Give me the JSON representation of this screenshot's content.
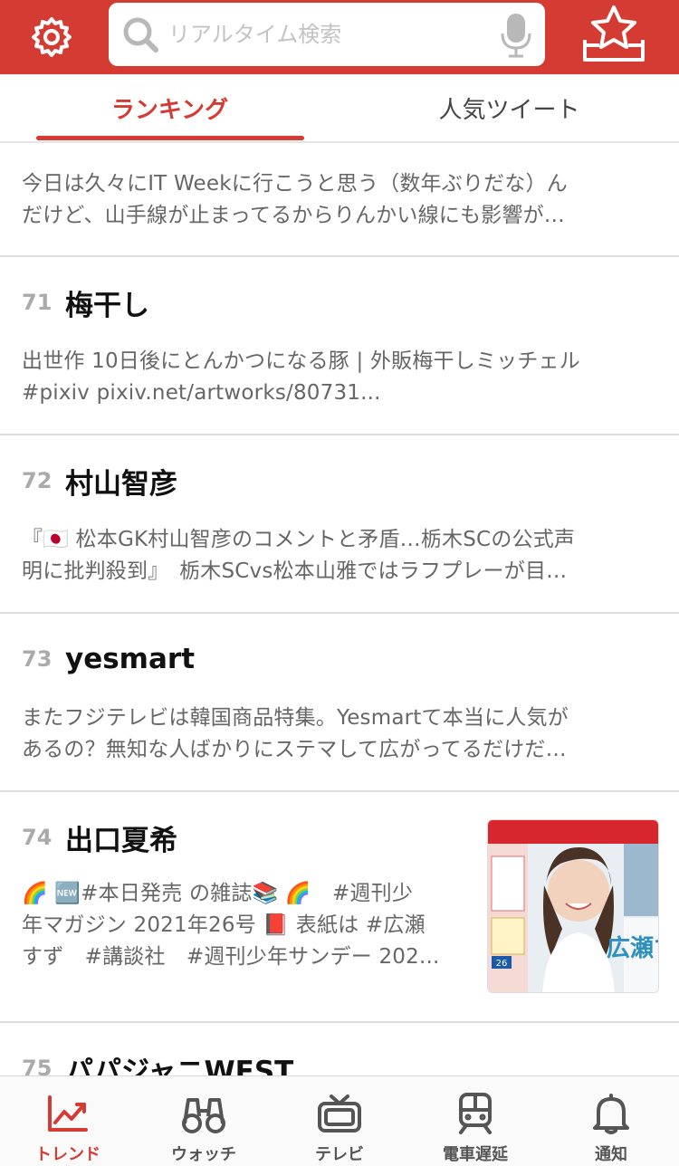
{
  "header": {
    "search_placeholder": "リアルタイム検索",
    "icons": {
      "settings": "gear-icon",
      "search": "search-icon",
      "mic": "microphone-icon",
      "saved": "star-tray-icon"
    }
  },
  "tabs": [
    {
      "label": "ランキング",
      "active": true
    },
    {
      "label": "人気ツイート",
      "active": false
    }
  ],
  "feed": {
    "top_snippet": [
      "今日は久々にIT Weekに行こうと思う（数年ぶりだな）ん",
      "だけど、山手線が止まってるからりんかい線にも影響が…"
    ],
    "items": [
      {
        "rank": "71",
        "title": "梅干し",
        "lines": [
          "出世作 10日後にとんかつになる豚 | 外販梅干しミッチェル",
          "#pixiv pixiv.net/artworks/80731..."
        ]
      },
      {
        "rank": "72",
        "title": "村山智彦",
        "lines": [
          "『🇯🇵 松本GK村山智彦のコメントと矛盾…栃木SCの公式声",
          "明に批判殺到』　栃木SCvs松本山雅ではラフプレーが目…"
        ]
      },
      {
        "rank": "73",
        "title": "yesmart",
        "lines": [
          "またフジテレビは韓国商品特集。Yesmartて本当に人気が",
          "あるの？無知な人ばかりにステマして広がってるだけだ…"
        ]
      },
      {
        "rank": "74",
        "title": "出口夏希",
        "lines": [
          "🌈 🆕#本日発売 の雑誌📚 🌈　#週刊少",
          "年マガジン 2021年26号 📕 表紙は #広瀬",
          "すず　#講談社　#週刊少年サンデー 202..."
        ],
        "thumbnail": {
          "cover_text": "広瀬す",
          "number": "26"
        }
      },
      {
        "rank": "75",
        "title": "パパジャニWEST"
      }
    ]
  },
  "bottom_nav": [
    {
      "label": "トレンド",
      "icon": "trend-chart-icon",
      "active": true
    },
    {
      "label": "ウォッチ",
      "icon": "binoculars-icon",
      "active": false
    },
    {
      "label": "テレビ",
      "icon": "tv-icon",
      "active": false
    },
    {
      "label": "電車遅延",
      "icon": "train-icon",
      "active": false
    },
    {
      "label": "通知",
      "icon": "bell-icon",
      "active": false
    }
  ],
  "colors": {
    "accent": "#d33b33",
    "text": "#111111",
    "muted": "#666666",
    "rank": "#aaaaaa"
  }
}
